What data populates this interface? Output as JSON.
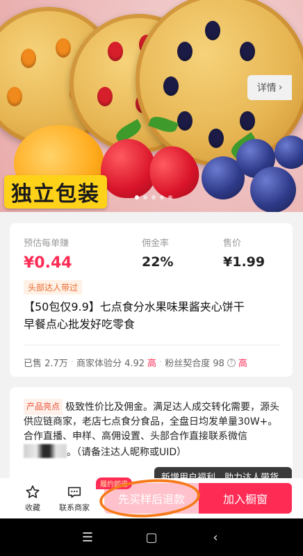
{
  "hero": {
    "badge": "独立包装",
    "carousel": {
      "count": 5,
      "active": 0
    }
  },
  "stats": [
    {
      "label": "预估每单赚",
      "value": "¥0.44"
    },
    {
      "label": "佣金率",
      "value": "22%"
    },
    {
      "label": "售价",
      "value": "¥1.99"
    }
  ],
  "product": {
    "tag": "头部达人带过",
    "title": "【50包仅9.9】七点食分水果味果酱夹心饼干早餐点心批发好吃零食",
    "detail_label": "详情",
    "detail_icon": "chevron-right-icon",
    "meta": {
      "sold": "已售 2.7万",
      "score_label": "商家体验分 4.92",
      "score_level": "高",
      "match_label": "粉丝契合度 98",
      "match_level": "高"
    }
  },
  "highlight": {
    "tag": "产品亮点",
    "text_before": "极致性价比及佣金。满足达人成交转化需要，源头供应链商家，老店七点食分食品，全盘日均发单量30W+。合作直播、申样、高佣设置、头部合作直接联系微信",
    "text_after": "。（请备注达人昵称或UID）"
  },
  "tooltip": "新增用户福利，助力达人带货",
  "bottom_bar": {
    "favorite": {
      "label": "收藏",
      "icon": "star-icon"
    },
    "contact": {
      "label": "联系商家",
      "icon": "chat-icon"
    },
    "refund_badge": "履约即退",
    "buy_sample": "先买样后退款",
    "add_window": "加入橱窗"
  },
  "nav": {
    "menu_icon": "menu-icon",
    "home_icon": "square-icon",
    "back_icon": "back-icon"
  },
  "colors": {
    "accent": "#fe2c55",
    "light_accent": "#ffc2cc",
    "annotation": "#f57a1a",
    "tag_orange": "#e86a2d"
  }
}
